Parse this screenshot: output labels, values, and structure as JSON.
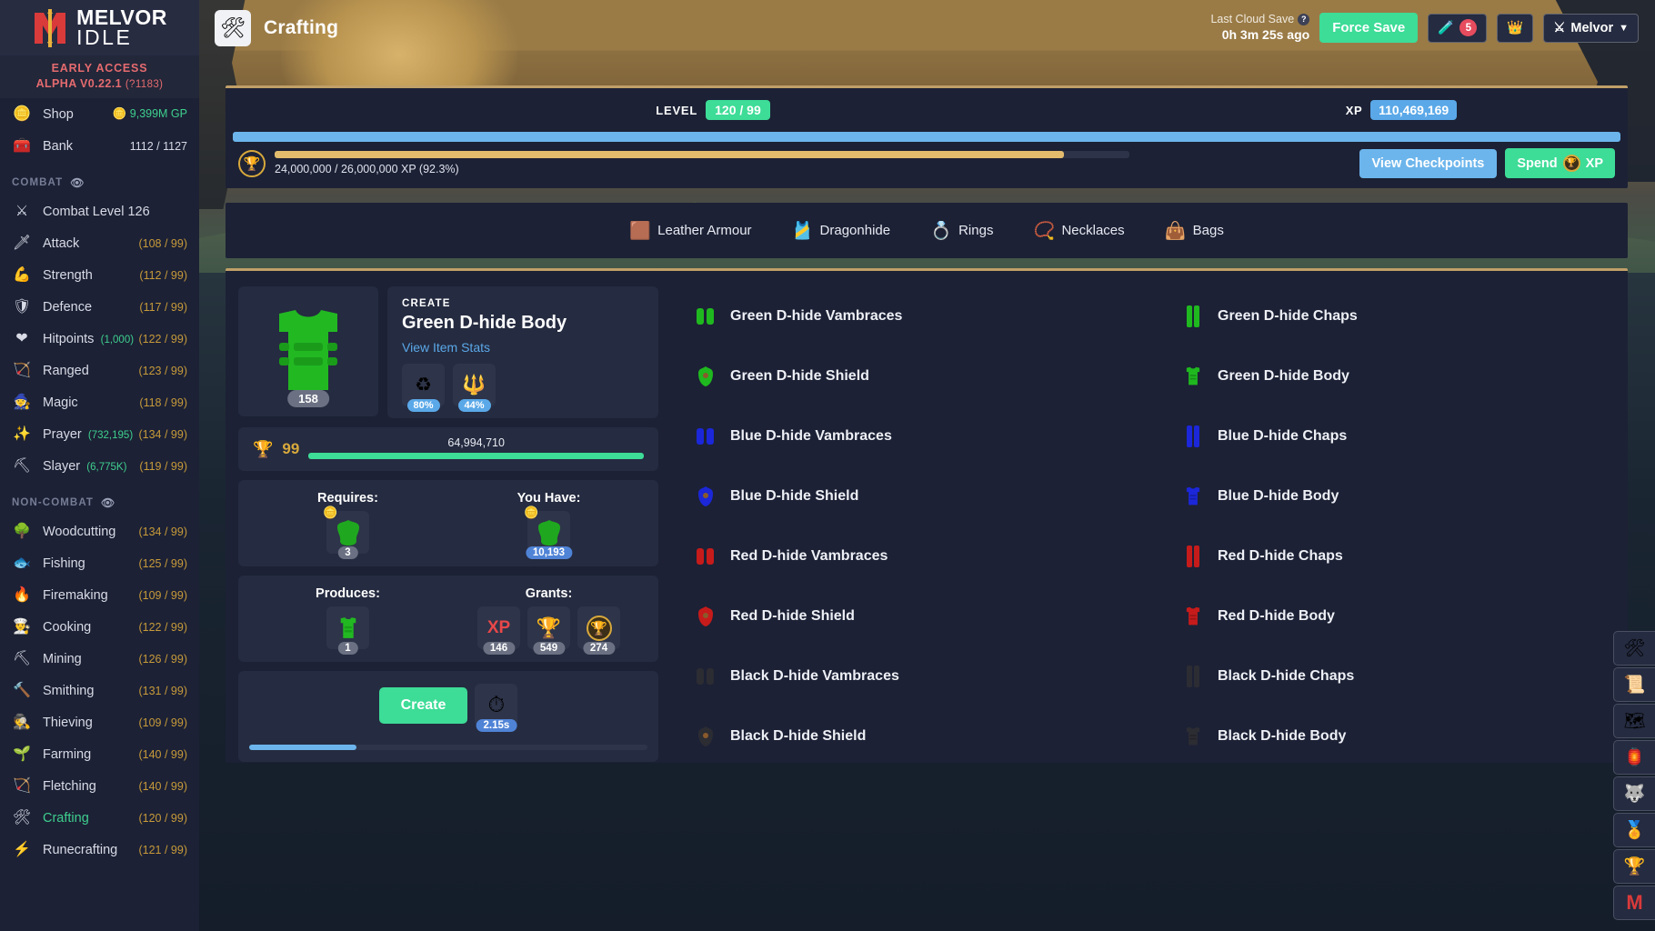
{
  "brand": {
    "line1": "MELVOR",
    "line2": "IDLE",
    "early_access": "EARLY ACCESS",
    "version": "ALPHA V0.22.1",
    "build": "(?1183)"
  },
  "sidebar": {
    "shop": {
      "label": "Shop",
      "icon": "coin-icon",
      "value": "9,399M GP"
    },
    "bank": {
      "label": "Bank",
      "icon": "chest-icon",
      "value": "1112 / 1127"
    },
    "combat_header": "COMBAT",
    "noncombat_header": "NON-COMBAT",
    "combat_items": [
      {
        "label": "Combat Level 126",
        "icon": "crossed-swords-icon",
        "value": ""
      },
      {
        "label": "Attack",
        "icon": "sword-icon",
        "value": "(108 / 99)"
      },
      {
        "label": "Strength",
        "icon": "flexed-biceps-icon",
        "value": "(112 / 99)"
      },
      {
        "label": "Defence",
        "icon": "shield-icon",
        "value": "(117 / 99)"
      },
      {
        "label": "Hitpoints",
        "icon": "heart-icon",
        "sub": "(1,000)",
        "value": "(122 / 99)"
      },
      {
        "label": "Ranged",
        "icon": "bow-and-arrow-icon",
        "value": "(123 / 99)"
      },
      {
        "label": "Magic",
        "icon": "wizard-hat-icon",
        "value": "(118 / 99)"
      },
      {
        "label": "Prayer",
        "icon": "sparkles-icon",
        "sub": "(732,195)",
        "value": "(134 / 99)"
      },
      {
        "label": "Slayer",
        "icon": "slayer-icon",
        "sub": "(6,775K)",
        "value": "(119 / 99)"
      }
    ],
    "noncombat_items": [
      {
        "label": "Woodcutting",
        "icon": "tree-icon",
        "value": "(134 / 99)"
      },
      {
        "label": "Fishing",
        "icon": "fish-icon",
        "value": "(125 / 99)"
      },
      {
        "label": "Firemaking",
        "icon": "campfire-icon",
        "value": "(109 / 99)"
      },
      {
        "label": "Cooking",
        "icon": "chef-hat-icon",
        "value": "(122 / 99)"
      },
      {
        "label": "Mining",
        "icon": "pickaxe-icon",
        "value": "(126 / 99)"
      },
      {
        "label": "Smithing",
        "icon": "anvil-icon",
        "value": "(131 / 99)"
      },
      {
        "label": "Thieving",
        "icon": "thief-icon",
        "value": "(109 / 99)"
      },
      {
        "label": "Farming",
        "icon": "seedling-icon",
        "value": "(140 / 99)"
      },
      {
        "label": "Fletching",
        "icon": "arrows-icon",
        "value": "(140 / 99)"
      },
      {
        "label": "Crafting",
        "icon": "crafting-tools-icon",
        "value": "(120 / 99)",
        "active": true
      },
      {
        "label": "Runecrafting",
        "icon": "rune-icon",
        "value": "(121 / 99)"
      }
    ]
  },
  "header": {
    "page_icon": "crafting-tools-icon",
    "title": "Crafting",
    "cloud_save_label": "Last Cloud Save",
    "cloud_save_time": "0h 3m 25s ago",
    "force_save_label": "Force Save",
    "potion_badge": "5",
    "potion_icon": "potion-icon",
    "crown_icon": "crown-icon",
    "account_icon": "crossed-swords-icon",
    "account_name": "Melvor",
    "chevron": "chevron-down-icon"
  },
  "level_panel": {
    "level_label": "LEVEL",
    "level_value": "120 / 99",
    "xp_label": "XP",
    "xp_value": "110,469,169",
    "level_progress_pct": 100,
    "mastery_text": "24,000,000 / 26,000,000 XP (92.3%)",
    "mastery_progress_pct": 92.3,
    "view_checkpoints_label": "View Checkpoints",
    "spend_label_pre": "Spend",
    "spend_label_post": "XP",
    "trophy_icon": "trophy-icon"
  },
  "categories": [
    {
      "label": "Leather Armour",
      "icon": "leather-icon"
    },
    {
      "label": "Dragonhide",
      "icon": "green-body-icon"
    },
    {
      "label": "Rings",
      "icon": "ring-icon"
    },
    {
      "label": "Necklaces",
      "icon": "necklace-icon"
    },
    {
      "label": "Bags",
      "icon": "bag-icon"
    }
  ],
  "selected_item": {
    "create_label": "CREATE",
    "name": "Green D-hide Body",
    "view_stats_label": "View Item Stats",
    "item_icon": "green-dhide-body-icon",
    "item_qty": "158",
    "modifiers": [
      {
        "icon": "recycle-icon",
        "value": "80%"
      },
      {
        "icon": "fork-arrows-icon",
        "value": "44%"
      }
    ],
    "mastery": {
      "icon": "trophy-icon",
      "level": "99",
      "xp": "64,994,710",
      "progress_pct": 100
    },
    "requires": {
      "title": "Requires:",
      "items": [
        {
          "icon": "green-dragonhide-icon",
          "qty": "3",
          "coin": "coin-icon"
        }
      ]
    },
    "you_have": {
      "title": "You Have:",
      "items": [
        {
          "icon": "green-dragonhide-icon",
          "qty": "10,193",
          "coin": "coin-icon"
        }
      ]
    },
    "produces": {
      "title": "Produces:",
      "items": [
        {
          "icon": "green-dhide-body-icon",
          "qty": "1"
        }
      ]
    },
    "grants": {
      "title": "Grants:",
      "items": [
        {
          "icon": "xp-text-icon",
          "qty": "146"
        },
        {
          "icon": "trophy-icon",
          "qty": "549"
        },
        {
          "icon": "mastery-pool-icon",
          "qty": "274"
        }
      ]
    },
    "create_button_label": "Create",
    "timer_icon": "stopwatch-icon",
    "timer_value": "2.15s",
    "action_progress_pct": 27
  },
  "item_grid": {
    "left_column": [
      {
        "name": "Green D-hide Vambraces",
        "icon": "vambraces-icon",
        "color": "#1fb81f"
      },
      {
        "name": "Green D-hide Shield",
        "icon": "shield-item-icon",
        "color": "#1fb81f"
      },
      {
        "name": "Blue D-hide Vambraces",
        "icon": "vambraces-icon",
        "color": "#1b27d8"
      },
      {
        "name": "Blue D-hide Shield",
        "icon": "shield-item-icon",
        "color": "#1b27d8"
      },
      {
        "name": "Red D-hide Vambraces",
        "icon": "vambraces-icon",
        "color": "#c61b1b"
      },
      {
        "name": "Red D-hide Shield",
        "icon": "shield-item-icon",
        "color": "#c61b1b"
      },
      {
        "name": "Black D-hide Vambraces",
        "icon": "vambraces-icon",
        "color": "#2c2c33"
      },
      {
        "name": "Black D-hide Shield",
        "icon": "shield-item-icon",
        "color": "#2c2c33"
      }
    ],
    "right_column": [
      {
        "name": "Green D-hide Chaps",
        "icon": "chaps-icon",
        "color": "#1fb81f"
      },
      {
        "name": "Green D-hide Body",
        "icon": "body-icon",
        "color": "#1fb81f"
      },
      {
        "name": "Blue D-hide Chaps",
        "icon": "chaps-icon",
        "color": "#1b27d8"
      },
      {
        "name": "Blue D-hide Body",
        "icon": "body-icon",
        "color": "#1b27d8"
      },
      {
        "name": "Red D-hide Chaps",
        "icon": "chaps-icon",
        "color": "#c61b1b"
      },
      {
        "name": "Red D-hide Body",
        "icon": "body-icon",
        "color": "#c61b1b"
      },
      {
        "name": "Black D-hide Chaps",
        "icon": "chaps-icon",
        "color": "#2c2c33"
      },
      {
        "name": "Black D-hide Body",
        "icon": "body-icon",
        "color": "#2c2c33"
      }
    ]
  },
  "dock": [
    {
      "icon": "crafting-tools-icon"
    },
    {
      "icon": "scroll-icon"
    },
    {
      "icon": "map-icon"
    },
    {
      "icon": "lantern-icon"
    },
    {
      "icon": "wolf-icon"
    },
    {
      "icon": "medal-icon"
    },
    {
      "icon": "trophy-icon"
    },
    {
      "icon": "melvor-m-icon"
    }
  ],
  "colors": {
    "accent_green": "#3ddc97",
    "accent_blue": "#6cb5ec",
    "gold": "#c79a3a",
    "panel": "#1c2135",
    "card": "#252b40"
  }
}
